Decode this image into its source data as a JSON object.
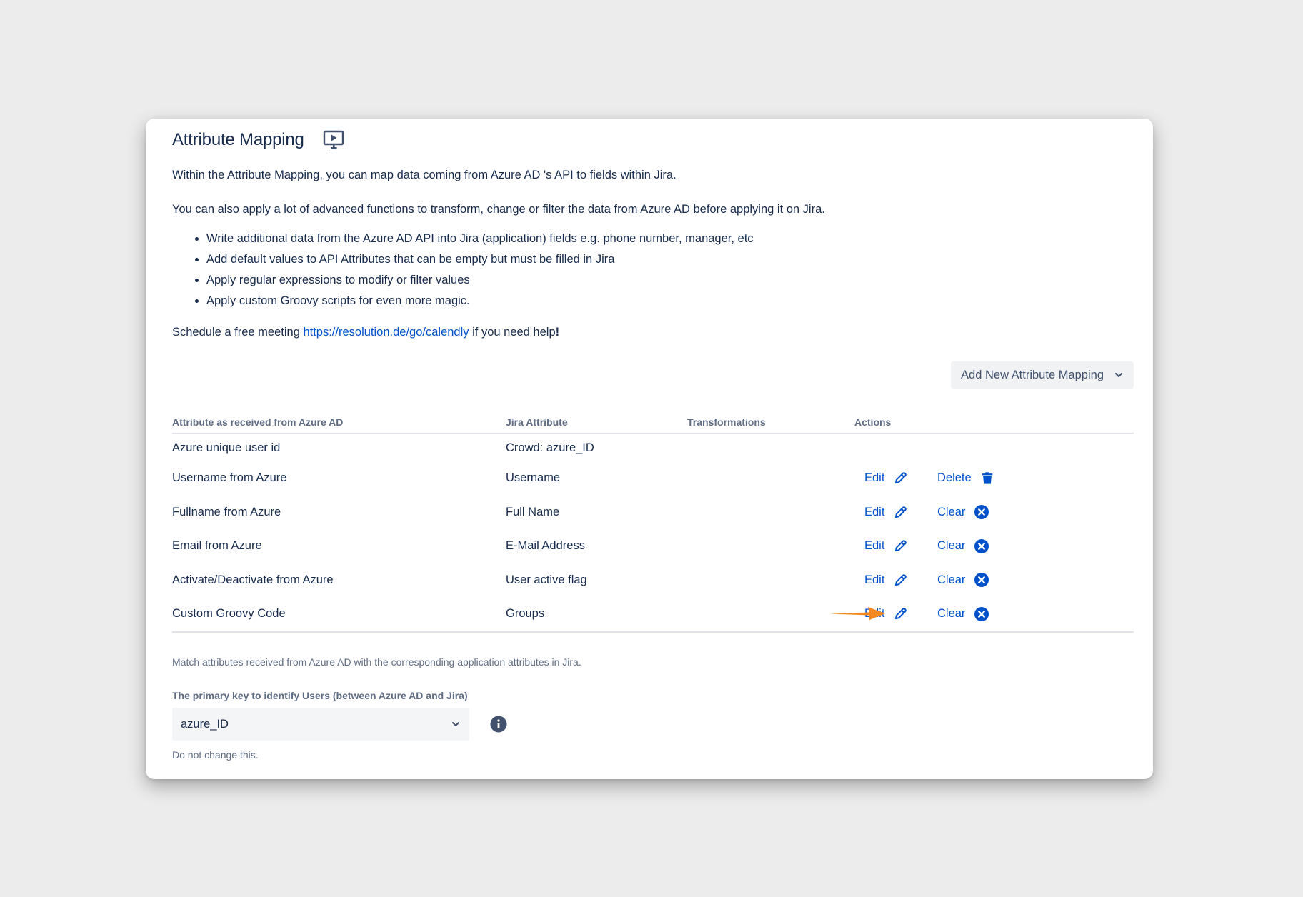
{
  "header": {
    "title": "Attribute Mapping",
    "demo_icon": "presentation-play-icon"
  },
  "intro": {
    "line1": "Within the Attribute Mapping, you can map data coming from Azure AD 's API to fields within Jira.",
    "line2": "You can also apply a lot of advanced functions to transform, change or filter the data from Azure AD before applying it on Jira.",
    "bullets": [
      "Write additional data from the Azure AD API into Jira (application) fields e.g. phone number, manager, etc",
      "Add default values to API Attributes that can be empty but must be filled in Jira",
      "Apply regular expressions to modify or filter values",
      "Apply custom Groovy scripts for even more magic."
    ],
    "schedule_prefix": "Schedule a free meeting ",
    "schedule_link": "https://resolution.de/go/calendly",
    "schedule_suffix": " if you need help",
    "schedule_end": "!"
  },
  "add_button": {
    "label": "Add New Attribute Mapping",
    "icon": "chevron-down-icon"
  },
  "table": {
    "headers": [
      "Attribute as received from Azure AD",
      "Jira Attribute",
      "Transformations",
      "Actions"
    ],
    "rows": [
      {
        "source": "Azure unique user id",
        "jira": "Crowd: azure_ID",
        "edit": "",
        "second": ""
      },
      {
        "source": "Username from Azure",
        "jira": "Username",
        "edit": "Edit",
        "second": "Delete"
      },
      {
        "source": "Fullname from Azure",
        "jira": "Full Name",
        "edit": "Edit",
        "second": "Clear"
      },
      {
        "source": "Email from Azure",
        "jira": "E-Mail Address",
        "edit": "Edit",
        "second": "Clear"
      },
      {
        "source": "Activate/Deactivate from Azure",
        "jira": "User active flag",
        "edit": "Edit",
        "second": "Clear"
      },
      {
        "source": "Custom Groovy Code",
        "jira": "Groups",
        "edit": "Edit",
        "second": "Clear"
      }
    ]
  },
  "helper_text": "Match attributes received from Azure AD with the corresponding application attributes in Jira.",
  "primary_key": {
    "label": "The primary key to identify Users (between Azure AD and Jira)",
    "selected": "azure_ID",
    "hint": "Do not change this."
  },
  "colors": {
    "link": "#0052cc",
    "text": "#172b4d",
    "muted": "#5e6c84",
    "arrow": "#f5891f"
  }
}
